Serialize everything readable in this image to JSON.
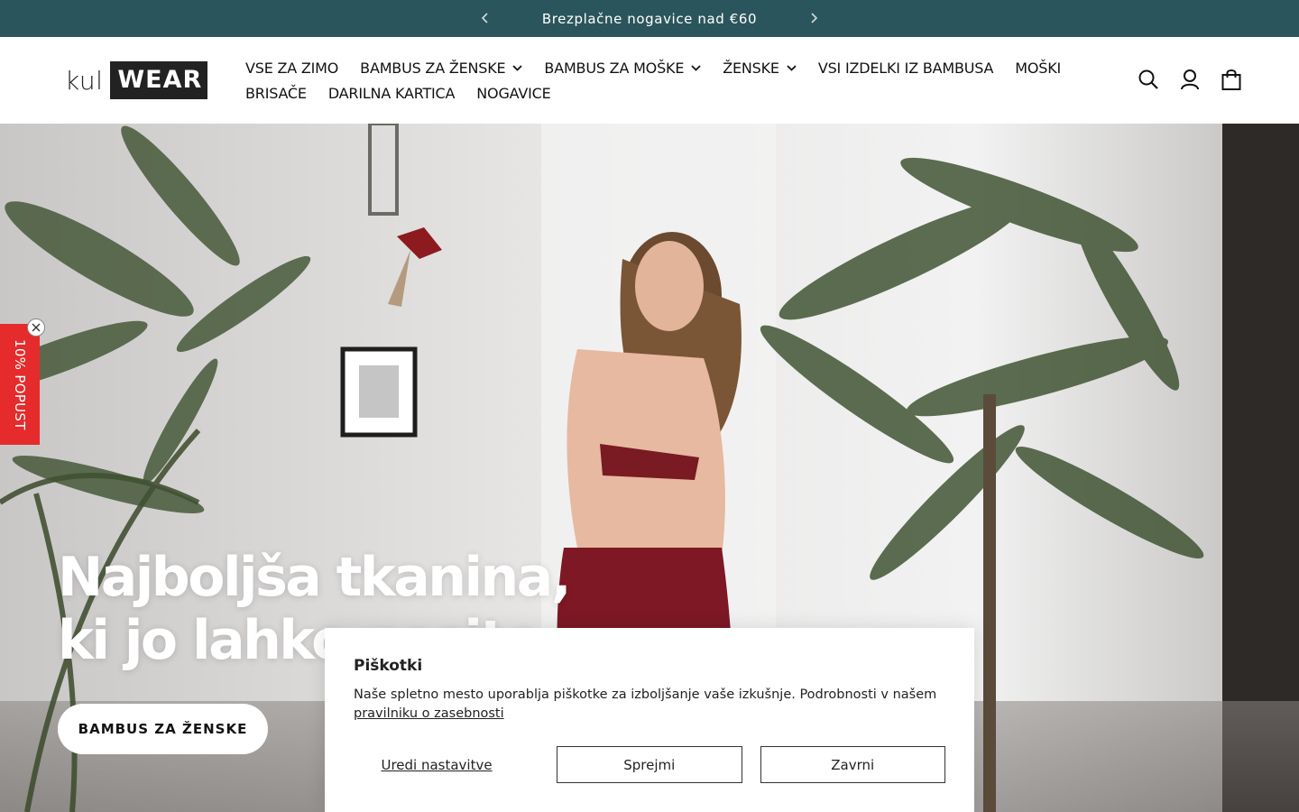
{
  "announcement": {
    "message": "Brezplačne nogavice nad €60"
  },
  "logo": {
    "part1": "kul",
    "part2": "WEAR"
  },
  "nav": {
    "row1": [
      {
        "label": "VSE ZA ZIMO",
        "dropdown": false
      },
      {
        "label": "BAMBUS ZA ŽENSKE",
        "dropdown": true
      },
      {
        "label": "BAMBUS ZA MOŠKE",
        "dropdown": true
      },
      {
        "label": "ŽENSKE",
        "dropdown": true
      },
      {
        "label": "VSI IZDELKI IZ BAMBUSA",
        "dropdown": false
      },
      {
        "label": "MOŠKI",
        "dropdown": false
      }
    ],
    "row2": [
      {
        "label": "BRISAČE",
        "dropdown": false
      },
      {
        "label": "DARILNA KARTICA",
        "dropdown": false
      },
      {
        "label": "NOGAVICE",
        "dropdown": false
      }
    ]
  },
  "header_icons": [
    "search-icon",
    "account-icon",
    "cart-icon"
  ],
  "hero": {
    "title_line1": "Najboljša tkanina,",
    "title_line2": "ki jo lahko nosite",
    "button": "BAMBUS ZA ŽENSKE"
  },
  "discount_tab": {
    "label": "10% POPUST"
  },
  "cookie": {
    "title": "Piškotki",
    "text": "Naše spletno mesto uporablja piškotke za izboljšanje vaše izkušnje. Podrobnosti v našem",
    "link": "pravilniku o zasebnosti",
    "manage": "Uredi nastavitve",
    "accept": "Sprejmi",
    "decline": "Zavrni"
  },
  "colors": {
    "announcement_bg": "#2b555c",
    "discount_bg": "#e52b2b",
    "text": "#121212"
  }
}
